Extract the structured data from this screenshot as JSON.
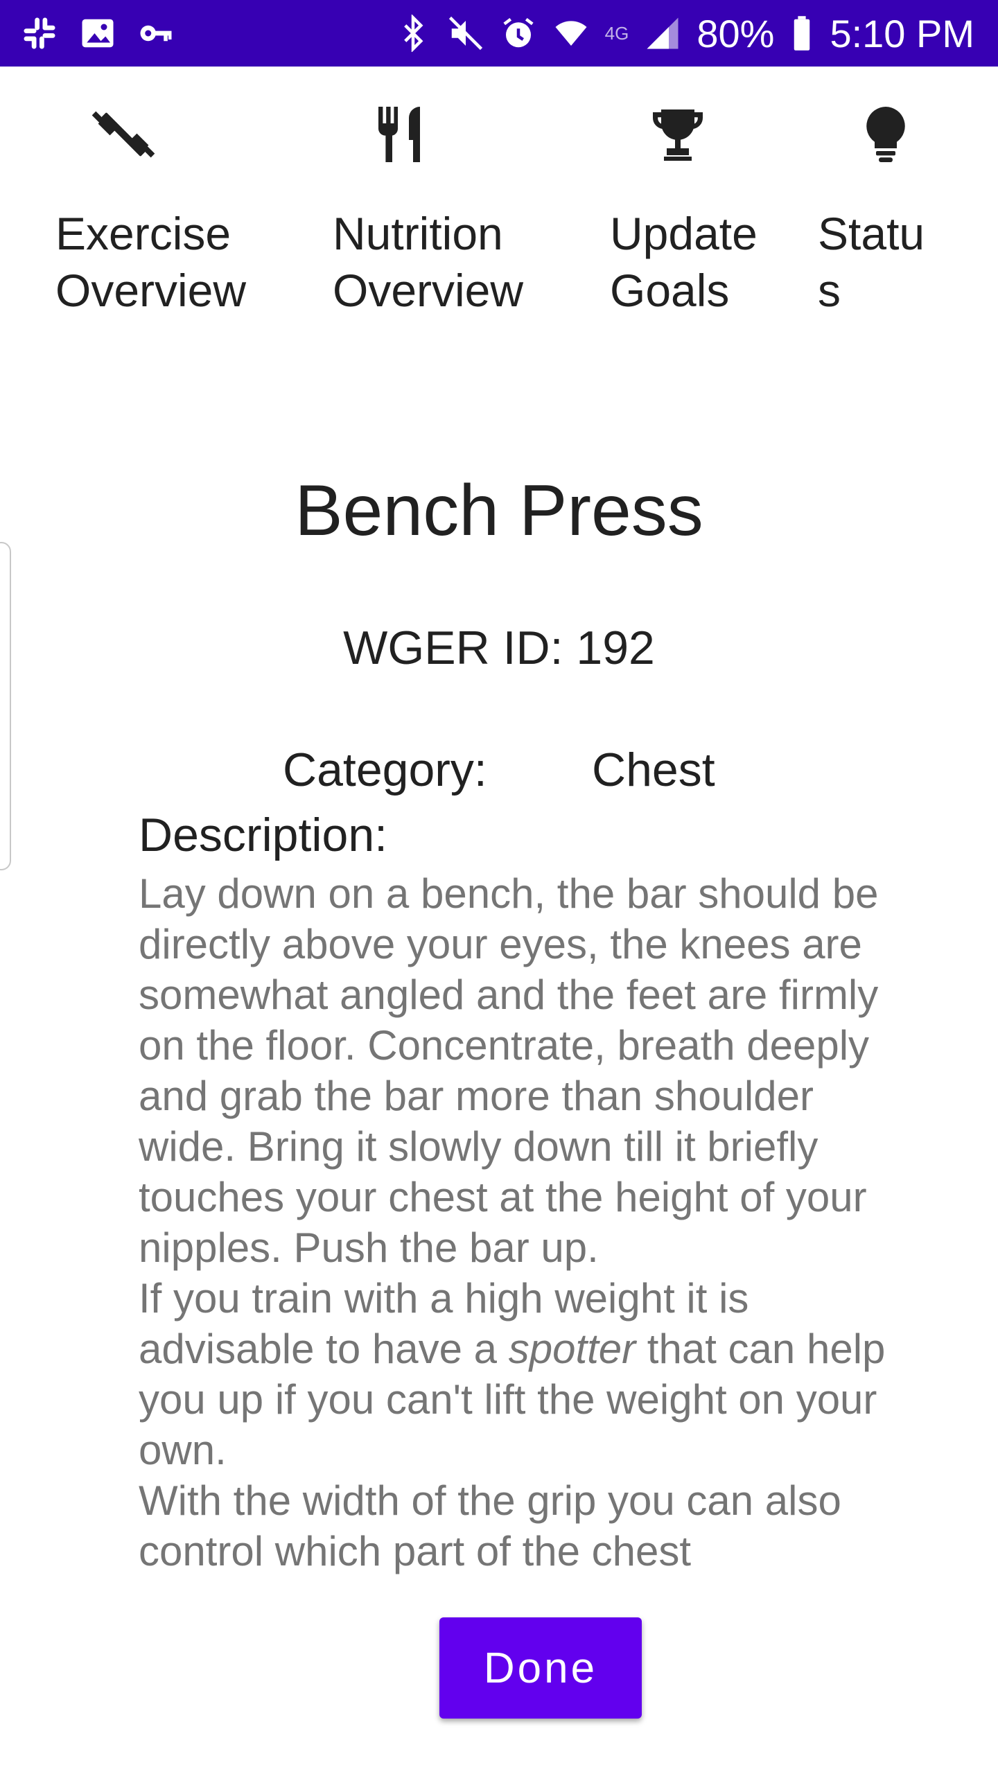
{
  "status_bar": {
    "battery": "80%",
    "time": "5:10 PM",
    "network": "4G",
    "colors": {
      "background": "#3700b3",
      "foreground": "#ffffff"
    }
  },
  "nav": {
    "items": [
      {
        "label": "Exercise\nOverview",
        "icon": "dumbbell-icon"
      },
      {
        "label": "Nutrition\nOverview",
        "icon": "fork-knife-icon"
      },
      {
        "label": "Update\nGoals",
        "icon": "trophy-icon"
      },
      {
        "label": "Statu\ns",
        "icon": "lightbulb-icon"
      }
    ]
  },
  "exercise": {
    "name": "Bench Press",
    "wger_id": "WGER ID: 192",
    "category_label": "Category:",
    "category_value": "Chest",
    "description_label": "Description:",
    "description": {
      "p1": "Lay down on a bench, the bar should be directly above your eyes, the knees are somewhat angled and the feet are firmly on the floor. Concentrate, breath deeply and grab the bar more than shoulder wide. Bring it slowly down till it briefly touches your chest at the height of your nipples. Push the bar up.",
      "p2_before": "If you train with a high weight it is advisable to have a ",
      "p2_em": "spotter",
      "p2_after": " that can help you up if you can't lift the weight on your own.",
      "p3": "With the width of the grip you can also control which part of the chest"
    }
  },
  "actions": {
    "done_label": "Done",
    "accent_color": "#6200ee"
  }
}
